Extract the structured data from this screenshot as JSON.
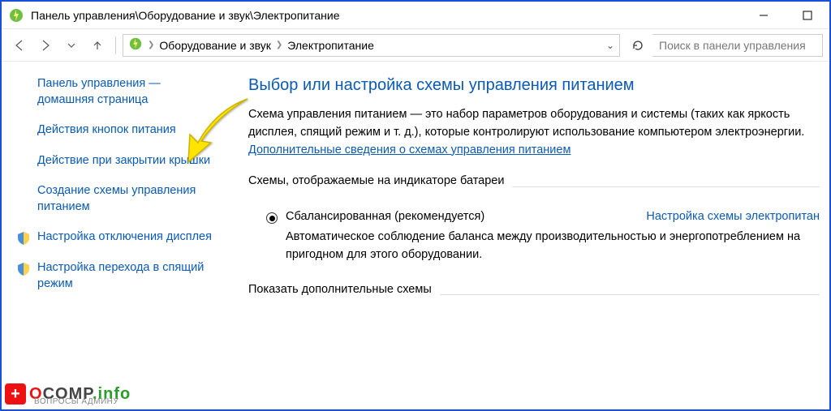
{
  "window": {
    "title": "Панель управления\\Оборудование и звук\\Электропитание"
  },
  "breadcrumb": {
    "item1": "Оборудование и звук",
    "item2": "Электропитание"
  },
  "search": {
    "placeholder": "Поиск в панели управления"
  },
  "sidebar": {
    "home": "Панель управления — домашняя страница",
    "item1": "Действия кнопок питания",
    "item2": "Действие при закрытии крышки",
    "item3": "Создание схемы управления питанием",
    "item4": "Настройка отключения дисплея",
    "item5": "Настройка перехода в спящий режим"
  },
  "main": {
    "heading": "Выбор или настройка схемы управления питанием",
    "desc_part1": "Схема управления питанием — это набор параметров оборудования и системы (таких как яркость дисплея, спящий режим и т. д.), которые контролируют использование компьютером электроэнергии. ",
    "desc_link": "Дополнительные сведения о схемах управления питанием",
    "group1": "Схемы, отображаемые на индикаторе батареи",
    "plan_name": "Сбалансированная (рекомендуется)",
    "plan_settings_link": "Настройка схемы электропитан",
    "plan_desc": "Автоматическое соблюдение баланса между производительностью и энергопотреблением на пригодном для этого оборудовании.",
    "group2": "Показать дополнительные схемы"
  },
  "watermark": {
    "o": "O",
    "comp": "COMP",
    "info": ".info",
    "sub": "ВОПРОСЫ АДМИНУ"
  }
}
